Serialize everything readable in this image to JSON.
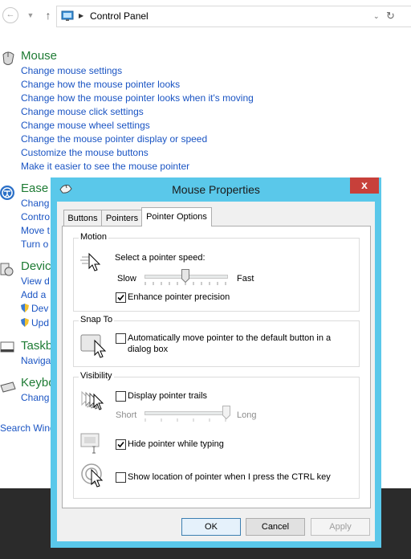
{
  "addressbar": {
    "path": "Control Panel"
  },
  "categories": [
    {
      "title": "Mouse",
      "links": [
        "Change mouse settings",
        "Change how the mouse pointer looks",
        "Change how the mouse pointer looks when it's moving",
        "Change mouse click settings",
        "Change mouse wheel settings",
        "Change the mouse pointer display or speed",
        "Customize the mouse buttons",
        "Make it easier to see the mouse pointer"
      ]
    },
    {
      "title": "Ease",
      "links": [
        "Chang",
        "Contro",
        "Move t",
        "Turn o"
      ]
    },
    {
      "title": "Devic",
      "links": [
        "View d",
        "Add a",
        "Dev",
        "Upd"
      ]
    },
    {
      "title": "Taskb",
      "links": [
        "Naviga"
      ]
    },
    {
      "title": "Keybo",
      "links": [
        "Chang"
      ]
    }
  ],
  "side_link": "Search Wind",
  "dialog": {
    "title": "Mouse Properties",
    "close_label": "x",
    "tabs": [
      "Buttons",
      "Pointers",
      "Pointer Options"
    ],
    "active_tab": "Pointer Options",
    "motion": {
      "group_label": "Motion",
      "speed_label": "Select a pointer speed:",
      "slow_label": "Slow",
      "fast_label": "Fast",
      "speed_level": 0.5,
      "precision_label": "Enhance pointer precision",
      "precision_checked": true
    },
    "snap_to": {
      "group_label": "Snap To",
      "snap_label_line1": "Automatically move pointer to the default button in a",
      "snap_label_line2": "dialog box",
      "snap_checked": false
    },
    "visibility": {
      "group_label": "Visibility",
      "trails_label": "Display pointer trails",
      "trails_checked": false,
      "short_label": "Short",
      "long_label": "Long",
      "trail_level": 1.0,
      "hide_label": "Hide pointer while typing",
      "hide_checked": true,
      "ctrl_label": "Show location of pointer when I press the CTRL key",
      "ctrl_checked": false
    },
    "buttons": {
      "ok": "OK",
      "cancel": "Cancel",
      "apply": "Apply"
    }
  }
}
